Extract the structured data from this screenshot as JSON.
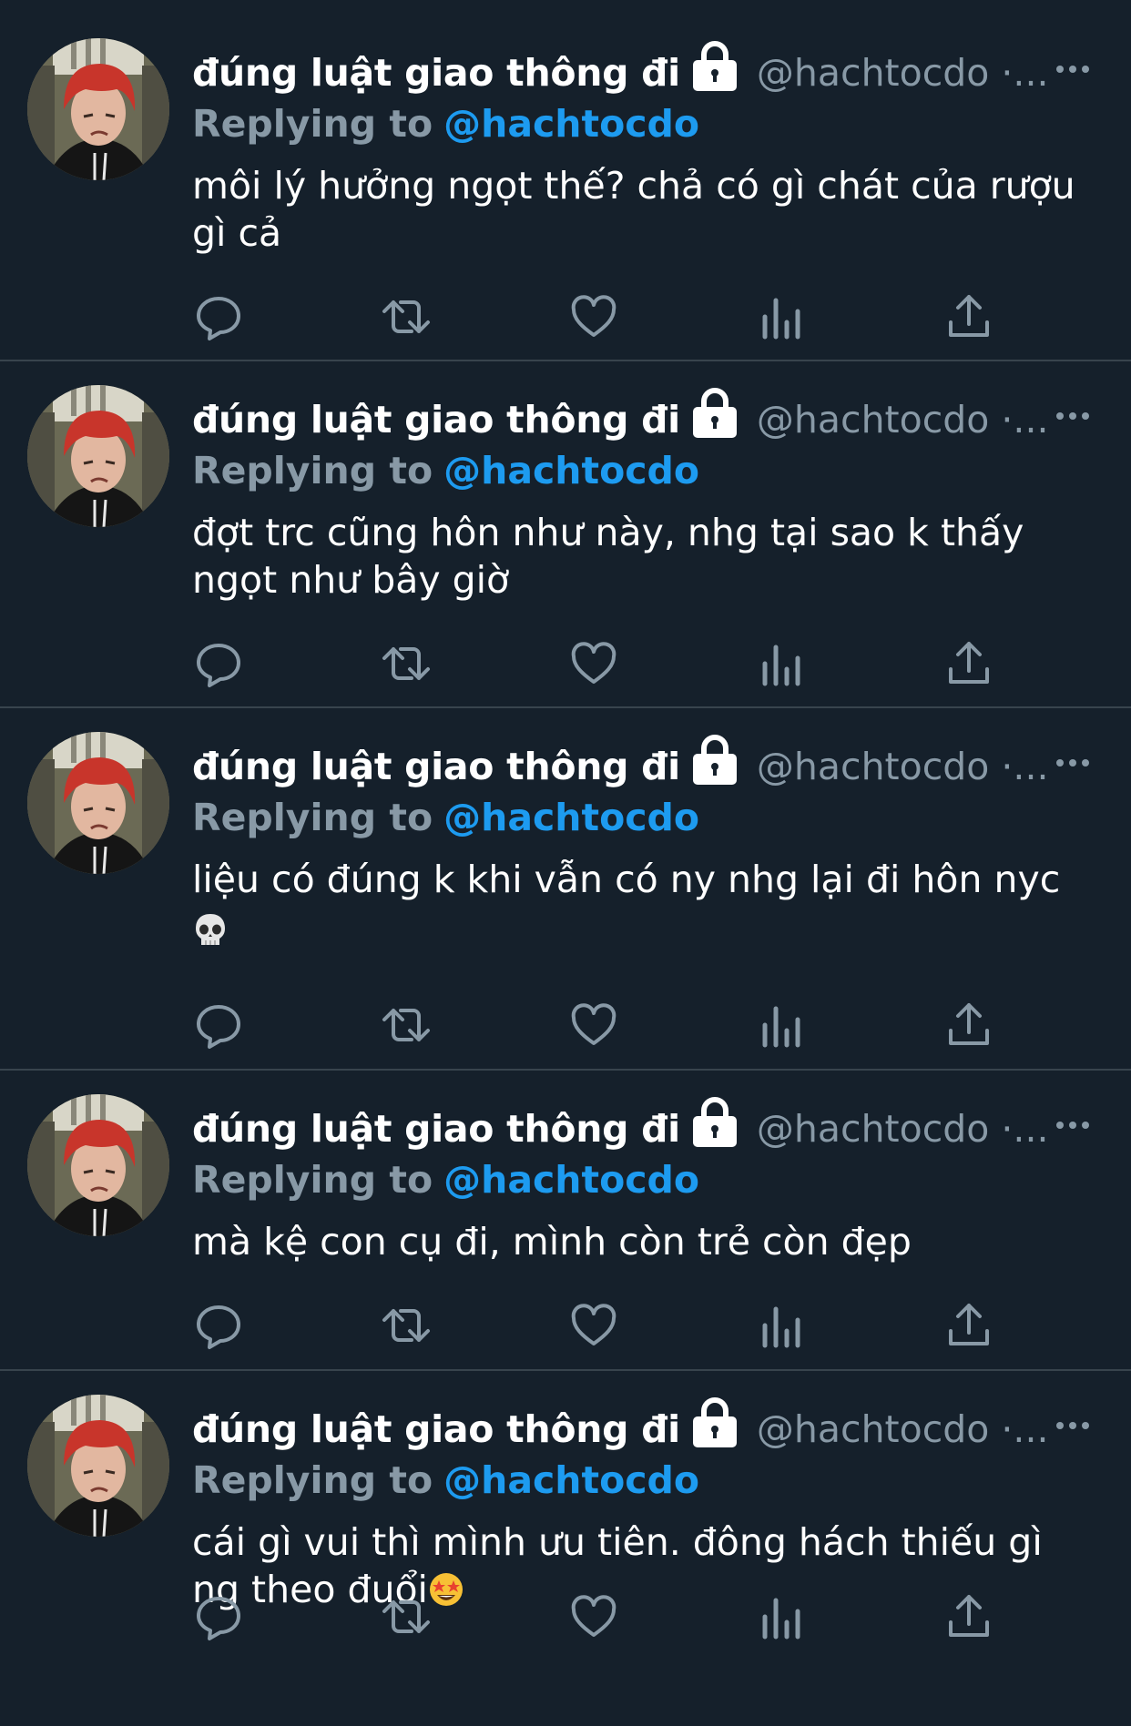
{
  "colors": {
    "background": "#15202b",
    "divider": "#38444d",
    "secondary_text": "#8899a6",
    "link": "#1d9bf0",
    "primary_text": "#ffffff"
  },
  "tweets": [
    {
      "name": "đúng luật giao thông đi",
      "handle": "@hachtocdo ·...",
      "reply_label": "Replying to",
      "reply_handle": "@hachtocdo",
      "content": "môi lý hưởng ngọt thế? chả có gì chát của rượu gì cả",
      "emoji": ""
    },
    {
      "name": "đúng luật giao thông đi",
      "handle": "@hachtocdo ·...",
      "reply_label": "Replying to",
      "reply_handle": "@hachtocdo",
      "content": "đợt trc cũng hôn như này, nhg tại sao k thấy ngọt như bây giờ",
      "emoji": ""
    },
    {
      "name": "đúng luật giao thông đi",
      "handle": "@hachtocdo ·...",
      "reply_label": "Replying to",
      "reply_handle": "@hachtocdo",
      "content": "liệu có đúng k khi vẫn có ny nhg lại đi hôn nyc",
      "emoji": "skull-emoji"
    },
    {
      "name": "đúng luật giao thông đi",
      "handle": "@hachtocdo ·...",
      "reply_label": "Replying to",
      "reply_handle": "@hachtocdo",
      "content": "mà kệ con cụ đi, mình còn trẻ còn đẹp",
      "emoji": ""
    },
    {
      "name": "đúng luật giao thông đi",
      "handle": "@hachtocdo ·...",
      "reply_label": "Replying to",
      "reply_handle": "@hachtocdo",
      "content": "cái gì vui thì mình ưu tiên. đông hách thiếu gì ng theo đuổi",
      "emoji": "star-struck-emoji"
    }
  ],
  "icons": {
    "lock": "lock-icon",
    "more": "more-icon",
    "reply": "reply-icon",
    "retweet": "retweet-icon",
    "like": "heart-icon",
    "analytics": "analytics-icon",
    "share": "share-icon"
  }
}
